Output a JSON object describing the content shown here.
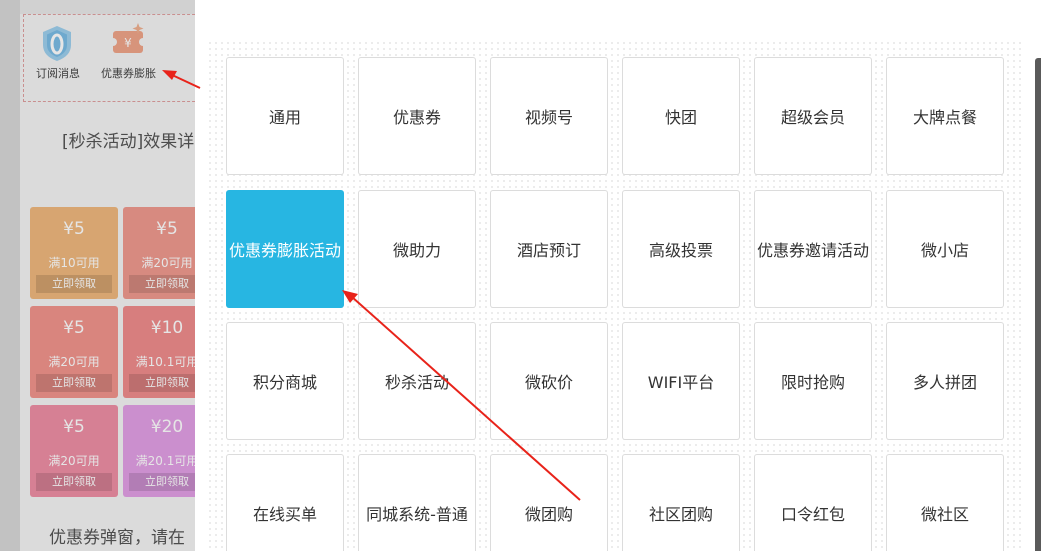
{
  "left_page": {
    "plugins": [
      {
        "label": "订阅消息",
        "icon": "subscribe-badge-icon"
      },
      {
        "label": "优惠券膨胀",
        "icon": "coupon-ticket-icon"
      }
    ],
    "effect_text": "[秒杀活动]效果详",
    "coupons": [
      {
        "value": "¥5",
        "condition": "满10可用",
        "button": "立即领取",
        "color": "#f0b87e"
      },
      {
        "value": "¥5",
        "condition": "满20可用",
        "button": "立即领取",
        "color": "#f09a8f"
      },
      {
        "value": "¥5",
        "condition": "满20可用",
        "button": "立即领取",
        "color": "#f2958d"
      },
      {
        "value": "¥10",
        "condition": "满10.1可用",
        "button": "立即领取",
        "color": "#f08d8d"
      },
      {
        "value": "¥5",
        "condition": "满20可用",
        "button": "立即领取",
        "color": "#ef8fa5"
      },
      {
        "value": "¥20",
        "condition": "满20.1可用",
        "button": "立即领取",
        "color": "#e3a0e6"
      }
    ],
    "popup_text": "优惠券弹窗，请在"
  },
  "activity_grid": {
    "selected": "优惠券膨胀活动",
    "items": [
      "通用",
      "优惠券",
      "视频号",
      "快团",
      "超级会员",
      "大牌点餐",
      "优惠券膨胀活动",
      "微助力",
      "酒店预订",
      "高级投票",
      "优惠券邀请活动",
      "微小店",
      "积分商城",
      "秒杀活动",
      "微砍价",
      "WIFI平台",
      "限时抢购",
      "多人拼团",
      "在线买单",
      "同城系统-普通",
      "微团购",
      "社区团购",
      "口令红包",
      "微社区"
    ]
  },
  "colors": {
    "selected_tile": "#27b6e2",
    "annotation_arrow": "#e8231a"
  }
}
